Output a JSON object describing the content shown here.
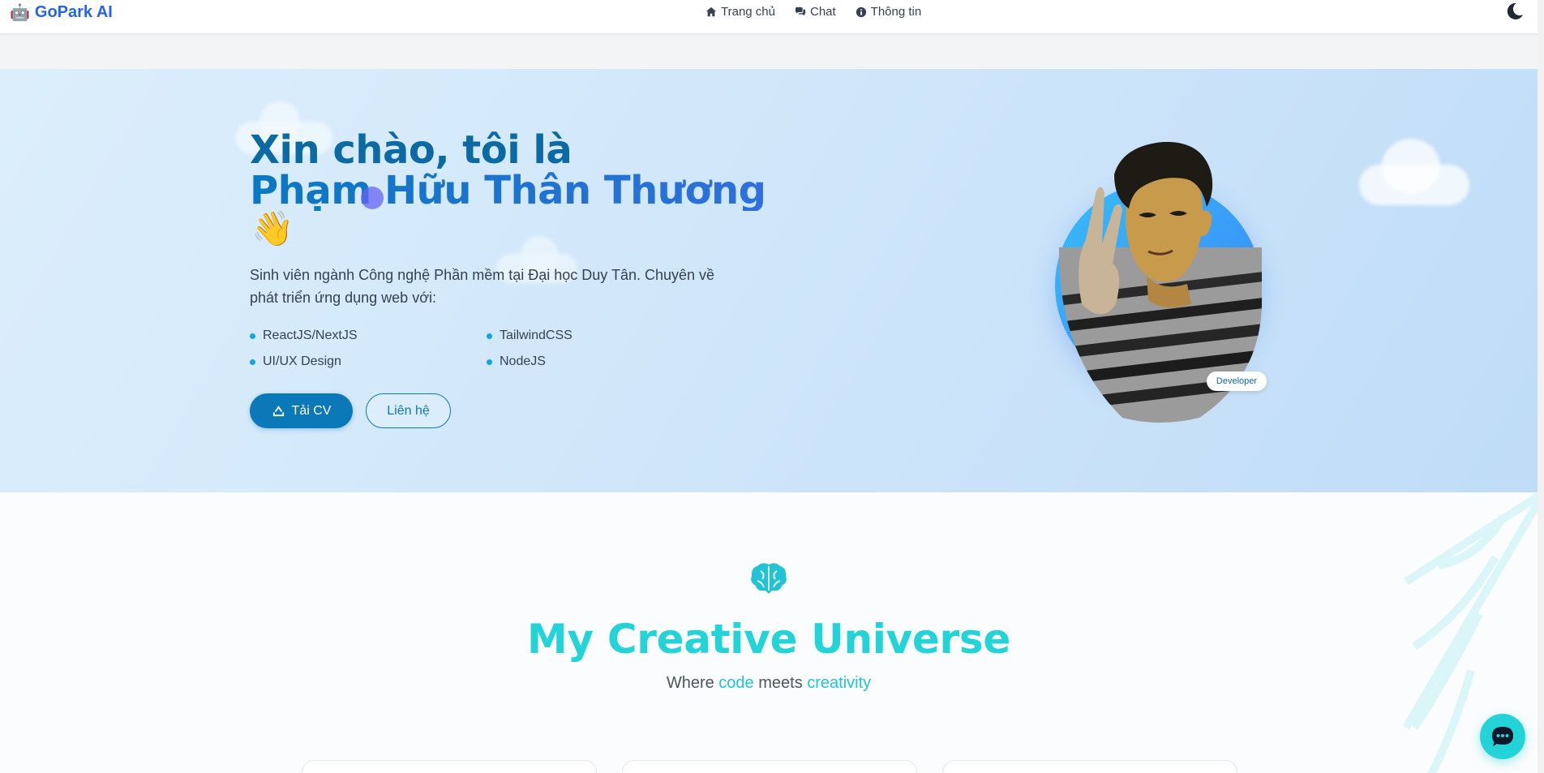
{
  "navbar": {
    "brand_icon": "🤖",
    "brand_name": "GoPark AI",
    "links": [
      {
        "label": "Trang chủ",
        "icon": "home-icon"
      },
      {
        "label": "Chat",
        "icon": "comments-icon"
      },
      {
        "label": "Thông tin",
        "icon": "info-circle-icon"
      }
    ],
    "theme_toggle_icon": "moon-icon"
  },
  "hero": {
    "title_line1": "Xin chào, tôi là",
    "title_line2": "Phạm Hữu Thân Thương",
    "wave_emoji": "👋",
    "description": "Sinh viên ngành Công nghệ Phần mềm tại Đại học Duy Tân. Chuyên về phát triển ứng dụng web với:",
    "skills": [
      "ReactJS/NextJS",
      "TailwindCSS",
      "UI/UX Design",
      "NodeJS"
    ],
    "cv_button": "Tải CV",
    "cv_button_icon": "download-icon",
    "contact_button": "Liên hệ",
    "badge": "Developer"
  },
  "section": {
    "icon": "brain-icon",
    "title": "My Creative Universe",
    "subtitle_parts": [
      "Where ",
      "code",
      " meets ",
      "creativity"
    ]
  },
  "chat_fab_icon": "chat-bubble-icon",
  "colors": {
    "brand": "#2563eb",
    "primary": "#0b78b8",
    "accent": "#22d3d8",
    "hero_bg": "#cfe6fa"
  }
}
